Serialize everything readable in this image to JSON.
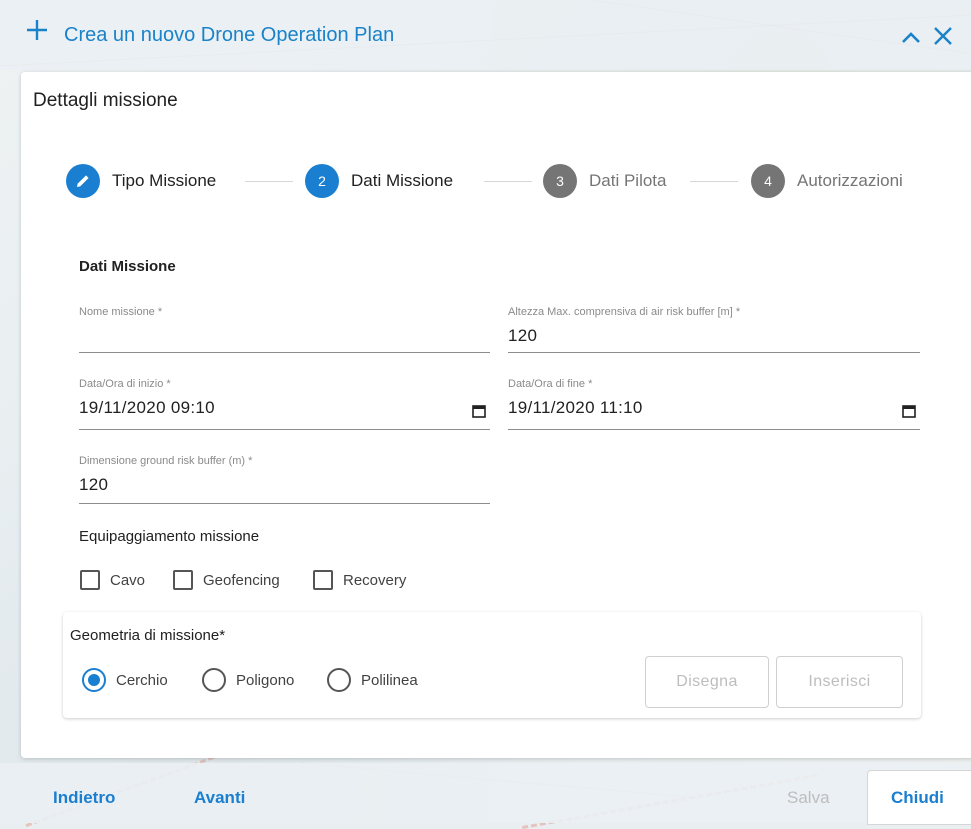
{
  "header": {
    "title": "Crea un nuovo Drone Operation Plan",
    "add_icon": "plus-icon",
    "collapse_icon": "chevron-up-icon",
    "close_icon": "close-icon"
  },
  "card": {
    "title": "Dettagli missione"
  },
  "stepper": {
    "steps": [
      {
        "number": "",
        "label": "Tipo Missione",
        "state": "completed",
        "icon": "pencil-icon"
      },
      {
        "number": "2",
        "label": "Dati Missione",
        "state": "active"
      },
      {
        "number": "3",
        "label": "Dati Pilota",
        "state": "inactive"
      },
      {
        "number": "4",
        "label": "Autorizzazioni",
        "state": "inactive"
      }
    ]
  },
  "form": {
    "section_title": "Dati Missione",
    "nome_missione": {
      "label": "Nome missione *",
      "value": ""
    },
    "altezza_max": {
      "label": "Altezza Max. comprensiva di air risk buffer [m] *",
      "value": "120"
    },
    "data_inizio": {
      "label": "Data/Ora di inizio *",
      "value": "19/11/2020 09:10"
    },
    "data_fine": {
      "label": "Data/Ora di fine *",
      "value": "19/11/2020 11:10"
    },
    "ground_buffer": {
      "label": "Dimensione ground risk buffer (m) *",
      "value": "120"
    },
    "equipaggiamento": {
      "label": "Equipaggiamento missione",
      "options": [
        {
          "label": "Cavo",
          "checked": false
        },
        {
          "label": "Geofencing",
          "checked": false
        },
        {
          "label": "Recovery",
          "checked": false
        }
      ]
    },
    "geometria": {
      "label": "Geometria di missione*",
      "options": [
        {
          "label": "Cerchio",
          "checked": true
        },
        {
          "label": "Poligono",
          "checked": false
        },
        {
          "label": "Polilinea",
          "checked": false
        }
      ],
      "disegna_label": "Disegna",
      "inserisci_label": "Inserisci"
    }
  },
  "footer": {
    "indietro_label": "Indietro",
    "avanti_label": "Avanti",
    "salva_label": "Salva",
    "chiudi_label": "Chiudi"
  },
  "colors": {
    "accent": "#1a7fd0",
    "inactive_step": "#757575",
    "disabled_text": "#bdbdbd"
  }
}
